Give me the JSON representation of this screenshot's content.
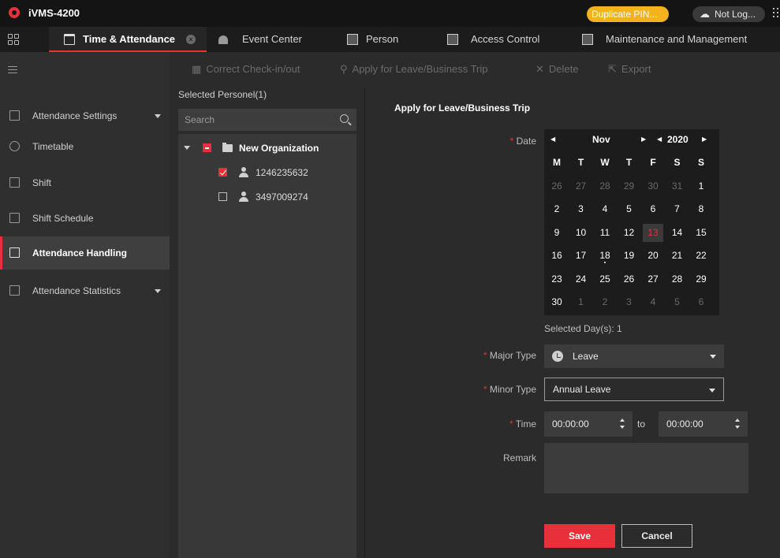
{
  "app": {
    "title": "iVMS-4200",
    "duplicate_pin": "Duplicate PIN...",
    "login": "Not Log..."
  },
  "tabs": [
    {
      "label": "Time & Attendance",
      "icon": "calendar-icon",
      "active": true
    },
    {
      "label": "Event Center",
      "icon": "alarm-icon"
    },
    {
      "label": "Person",
      "icon": "person-card-icon"
    },
    {
      "label": "Access Control",
      "icon": "door-icon"
    },
    {
      "label": "Maintenance and Management",
      "icon": "maintenance-icon"
    }
  ],
  "sidebar": {
    "items": [
      {
        "label": "Attendance Settings",
        "icon": "calendar-icon",
        "has_arrow": true
      },
      {
        "label": "Timetable",
        "icon": "clock-icon"
      },
      {
        "label": "Shift",
        "icon": "shift-icon"
      },
      {
        "label": "Shift Schedule",
        "icon": "schedule-icon"
      },
      {
        "label": "Attendance Handling",
        "icon": "handling-icon",
        "active": true
      },
      {
        "label": "Attendance Statistics",
        "icon": "statistics-icon",
        "has_arrow": true
      }
    ]
  },
  "toolbar": {
    "correct": "Correct Check-in/out",
    "apply": "Apply for Leave/Business Trip",
    "delete": "Delete",
    "export": "Export"
  },
  "personnel": {
    "title": "Selected Personel(1)",
    "search_placeholder": "Search",
    "org": "New Organization",
    "persons": [
      {
        "id": "1246235632",
        "checked": true
      },
      {
        "id": "3497009274",
        "checked": false
      }
    ]
  },
  "form": {
    "title": "Apply for Leave/Business Trip",
    "required_mark": "*",
    "date_label": "Date",
    "calendar": {
      "month": "Nov",
      "year": "2020",
      "weekdays": [
        "M",
        "T",
        "W",
        "T",
        "F",
        "S",
        "S"
      ],
      "weeks": [
        [
          "26",
          "27",
          "28",
          "29",
          "30",
          "31",
          "1"
        ],
        [
          "2",
          "3",
          "4",
          "5",
          "6",
          "7",
          "8"
        ],
        [
          "9",
          "10",
          "11",
          "12",
          "13",
          "14",
          "15"
        ],
        [
          "16",
          "17",
          "18",
          "19",
          "20",
          "21",
          "22"
        ],
        [
          "23",
          "24",
          "25",
          "26",
          "27",
          "28",
          "29"
        ],
        [
          "30",
          "1",
          "2",
          "3",
          "4",
          "5",
          "6"
        ]
      ],
      "highlighted_day": "13",
      "dotted_day": "18"
    },
    "selected_days": "Selected Day(s): 1",
    "major_type_label": "Major Type",
    "major_type_value": "Leave",
    "minor_type_label": "Minor Type",
    "minor_type_value": "Annual Leave",
    "time_label": "Time",
    "time_from": "00:00:00",
    "time_to_word": "to",
    "time_to": "00:00:00",
    "remark_label": "Remark",
    "save": "Save",
    "cancel": "Cancel"
  },
  "colors": {
    "accent": "#e8303a",
    "warning": "#f4b31c",
    "background": "#2b2b2b"
  }
}
